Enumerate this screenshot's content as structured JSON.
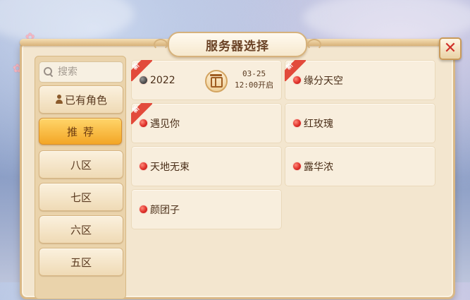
{
  "dialog": {
    "title": "服务器选择",
    "close_icon": "close-x-icon"
  },
  "sidebar": {
    "search_placeholder": "搜索",
    "items": [
      {
        "label": "已有角色",
        "icon": "person-icon"
      },
      {
        "label": "推荐",
        "active": true
      },
      {
        "label": "八区"
      },
      {
        "label": "七区"
      },
      {
        "label": "六区"
      },
      {
        "label": "五区"
      }
    ]
  },
  "servers": [
    {
      "name": "2022",
      "status": "grey",
      "is_new": true,
      "new_label": "新",
      "opening_date": "03-25",
      "opening_time": "12:00开启",
      "gift_icon": "gift-icon"
    },
    {
      "name": "缘分天空",
      "status": "red",
      "is_new": true,
      "new_label": "新"
    },
    {
      "name": "遇见你",
      "status": "red",
      "is_new": true,
      "new_label": "新"
    },
    {
      "name": "红玫瑰",
      "status": "red"
    },
    {
      "name": "天地无束",
      "status": "red"
    },
    {
      "name": "露华浓",
      "status": "red"
    },
    {
      "name": "颜团子",
      "status": "red"
    }
  ],
  "colors": {
    "status_red": "#e0302a",
    "status_grey": "#4b4b4b",
    "active_tab": "#f3a626",
    "new_tag": "#e24a3b"
  }
}
